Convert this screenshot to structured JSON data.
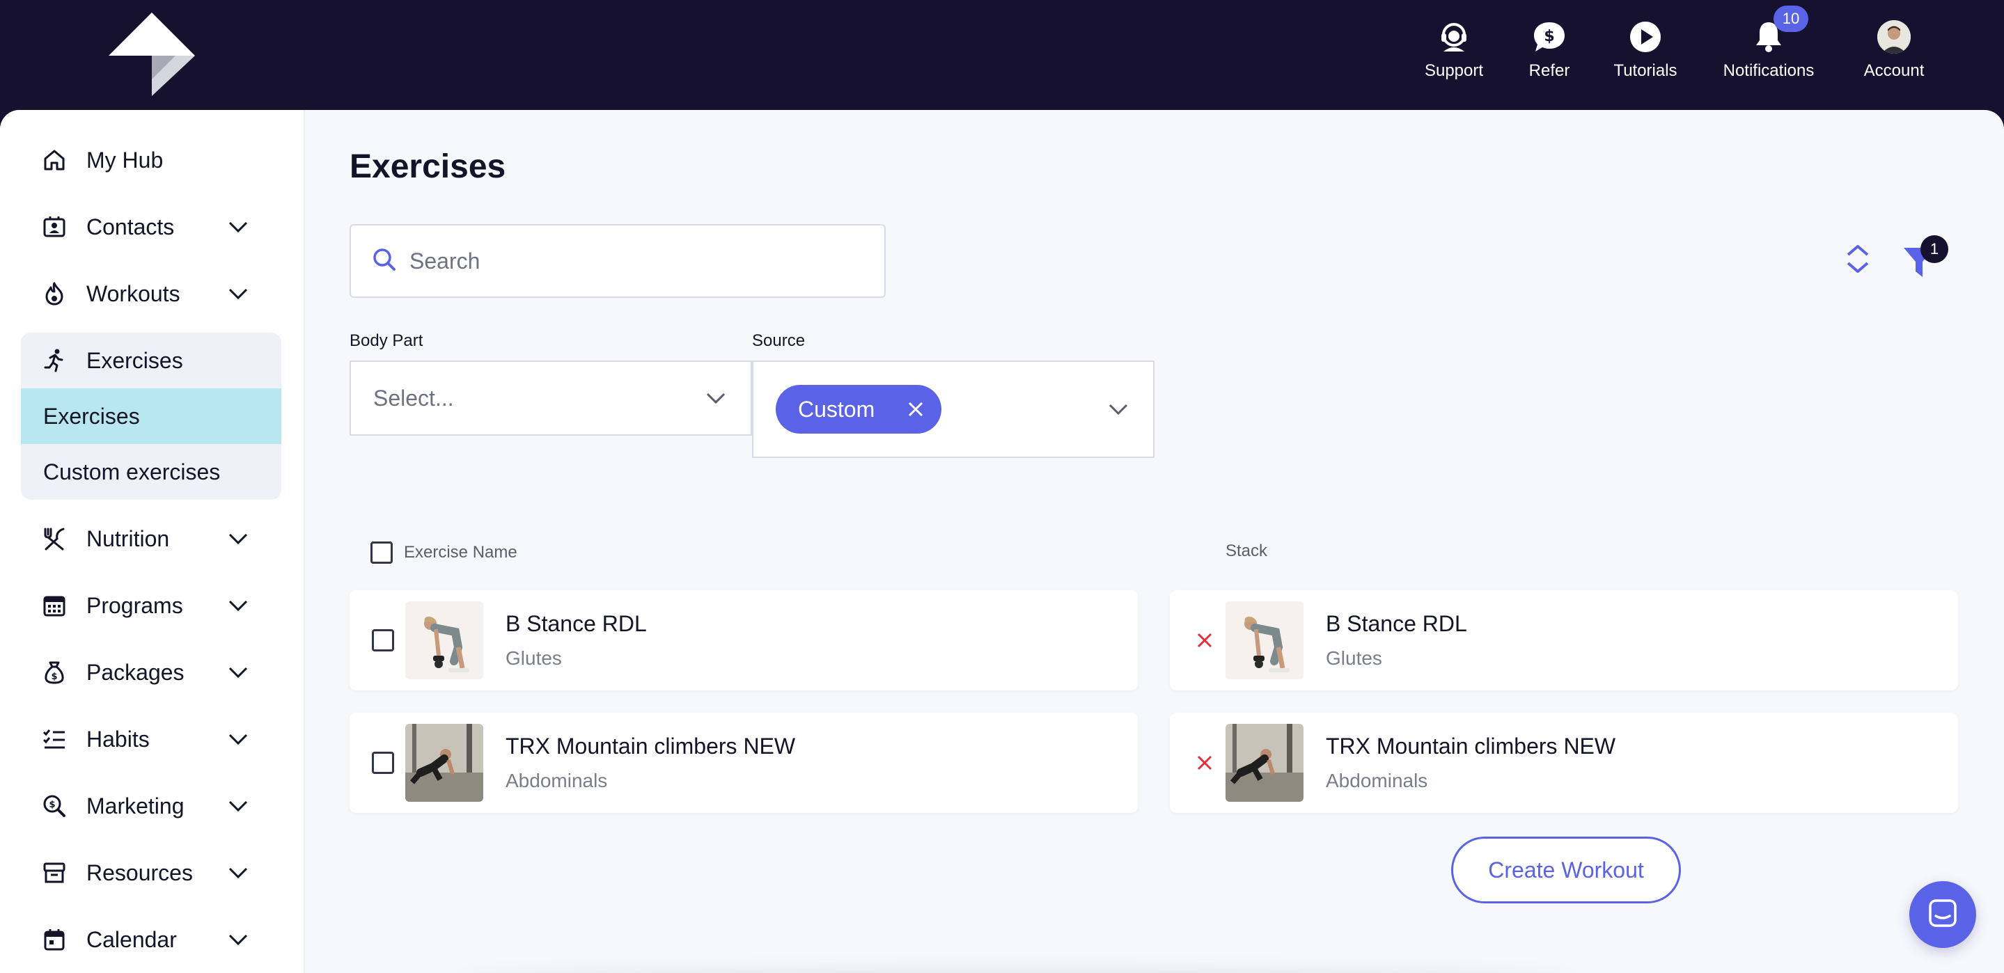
{
  "header": {
    "nav": [
      {
        "label": "Support",
        "icon": "support-icon"
      },
      {
        "label": "Refer",
        "icon": "dollar-chat-icon"
      },
      {
        "label": "Tutorials",
        "icon": "play-icon"
      },
      {
        "label": "Notifications",
        "icon": "bell-icon",
        "badge": "10"
      },
      {
        "label": "Account",
        "icon": "avatar"
      }
    ]
  },
  "sidebar": {
    "items": [
      {
        "label": "My Hub",
        "icon": "home-icon"
      },
      {
        "label": "Contacts",
        "icon": "contacts-icon"
      },
      {
        "label": "Workouts",
        "icon": "flame-icon"
      },
      {
        "label": "Exercises",
        "icon": "running-icon"
      },
      {
        "label": "Nutrition",
        "icon": "utensils-icon"
      },
      {
        "label": "Programs",
        "icon": "calendar-grid-icon"
      },
      {
        "label": "Packages",
        "icon": "money-bag-icon"
      },
      {
        "label": "Habits",
        "icon": "checklist-icon"
      },
      {
        "label": "Marketing",
        "icon": "search-dollar-icon"
      },
      {
        "label": "Resources",
        "icon": "archive-icon"
      },
      {
        "label": "Calendar",
        "icon": "calendar-icon"
      }
    ],
    "exercise_sub": [
      "Exercises",
      "Custom exercises"
    ]
  },
  "main": {
    "title": "Exercises",
    "search_placeholder": "Search",
    "filters_count": "1",
    "body_part_label": "Body Part",
    "body_part_placeholder": "Select...",
    "source_label": "Source",
    "source_chip": "Custom",
    "col_exercise_name": "Exercise Name",
    "col_stack": "Stack",
    "exercises": [
      {
        "name": "B Stance RDL",
        "body_part": "Glutes"
      },
      {
        "name": "TRX Mountain climbers NEW",
        "body_part": "Abdominals"
      }
    ],
    "stack": [
      {
        "name": "B Stance RDL",
        "body_part": "Glutes"
      },
      {
        "name": "TRX Mountain climbers NEW",
        "body_part": "Abdominals"
      }
    ],
    "create_button": "Create Workout"
  },
  "colors": {
    "header_bg": "#16112f",
    "accent": "#5a63e6",
    "active_sub_bg": "#b8e7ef",
    "remove_red": "#e0313f"
  }
}
